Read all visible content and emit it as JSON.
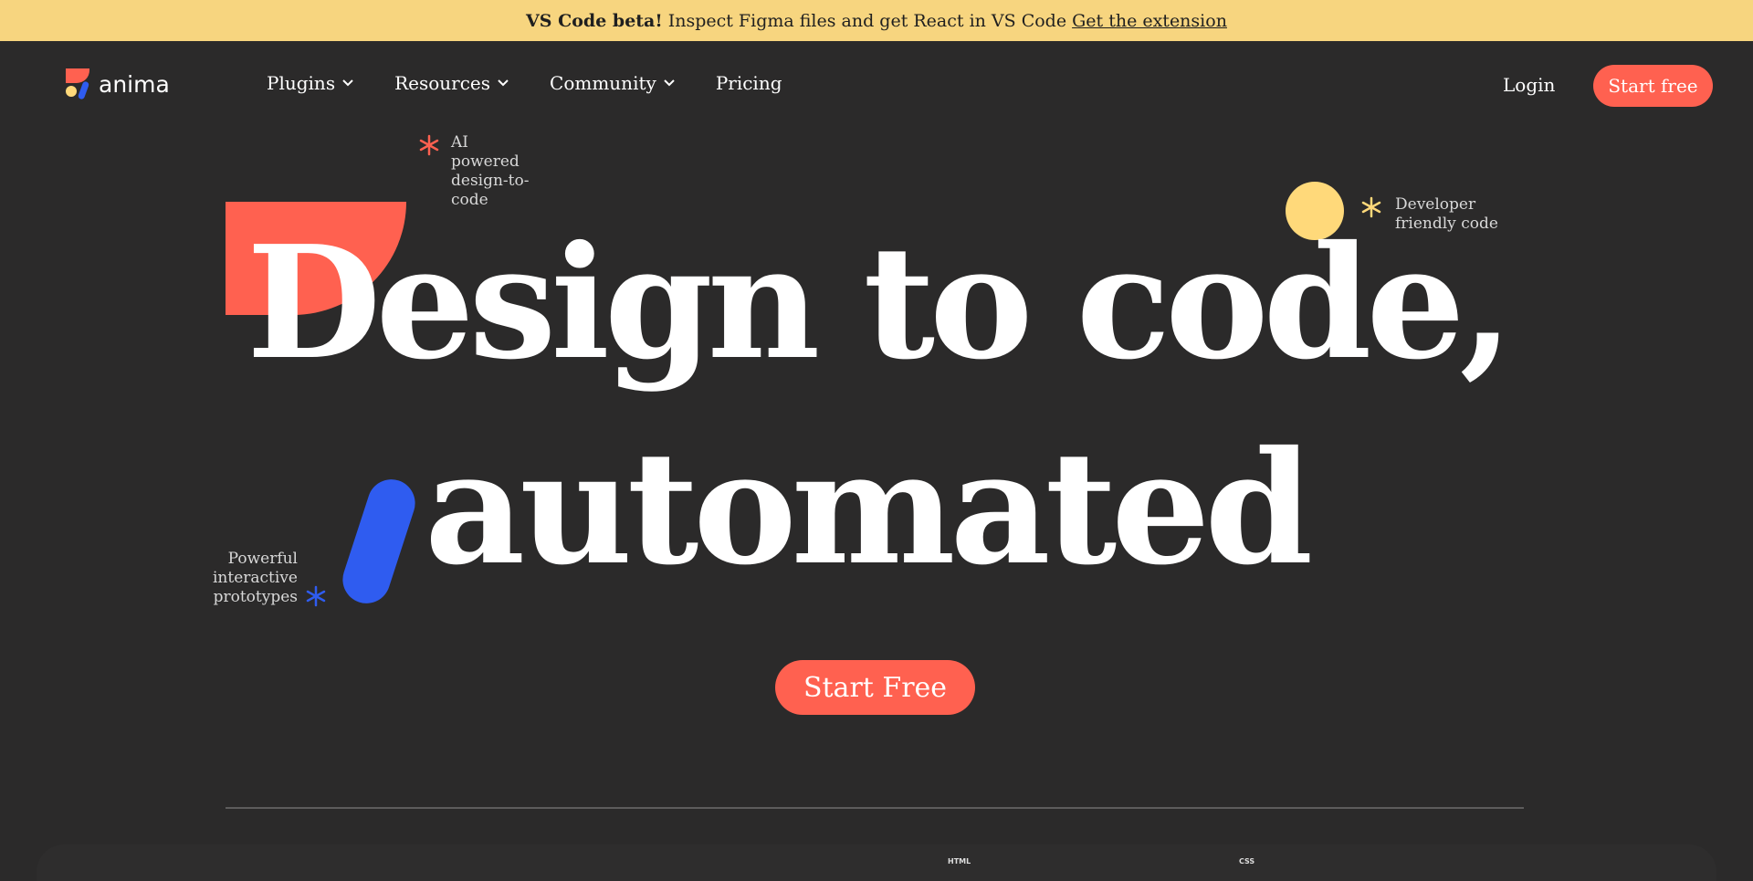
{
  "banner": {
    "bold": "VS Code beta!",
    "text": "Inspect Figma files and get React in VS Code",
    "link": "Get the extension"
  },
  "nav": {
    "logo": "anima",
    "items": [
      {
        "label": "Plugins",
        "has_dropdown": true
      },
      {
        "label": "Resources",
        "has_dropdown": true
      },
      {
        "label": "Community",
        "has_dropdown": true
      },
      {
        "label": "Pricing",
        "has_dropdown": false
      }
    ],
    "login": "Login",
    "start_free": "Start free"
  },
  "hero": {
    "line1": "Design to code,",
    "line2": "automated",
    "cta": "Start Free"
  },
  "tags": {
    "ai": "AI powered design-to-code",
    "dev": "Developer friendly code",
    "proto": "Powerful interactive prototypes"
  },
  "bottom": {
    "html_label": "HTML",
    "css_label": "CSS"
  },
  "colors": {
    "background": "#2b2a2a",
    "banner": "#f7d57f",
    "accent_red": "#ff6150",
    "accent_yellow": "#ffd97a",
    "accent_blue": "#2f5cf0"
  }
}
